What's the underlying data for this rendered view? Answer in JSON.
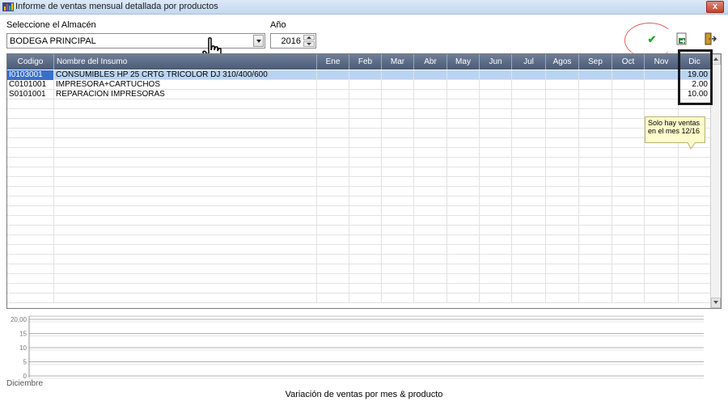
{
  "window": {
    "title": "Informe de ventas mensual detallada por productos",
    "close_label": "x"
  },
  "form": {
    "warehouse_label": "Seleccione el Almacén",
    "warehouse_value": "BODEGA PRINCIPAL",
    "year_label": "Año",
    "year_value": "2016"
  },
  "toolbar": {
    "ok_icon": "check-icon",
    "export_icon": "export-excel-icon",
    "exit_icon": "exit-door-icon"
  },
  "grid": {
    "columns": [
      "Codigo",
      "Nombre del Insumo",
      "Ene",
      "Feb",
      "Mar",
      "Abr",
      "May",
      "Jun",
      "Jul",
      "Agos",
      "Sep",
      "Oct",
      "Nov",
      "Dic"
    ],
    "rows": [
      {
        "code": "I0103001",
        "name": "CONSUMIBLES HP 25 CRTG TRICOLOR DJ 310/400/600",
        "dic": "19.00",
        "selected": true
      },
      {
        "code": "C0101001",
        "name": "IMPRESORA+CARTUCHOS",
        "dic": "2.00",
        "selected": false
      },
      {
        "code": "S0101001",
        "name": "REPARACIÓN IMPRESORAS",
        "dic": "10.00",
        "selected": false
      }
    ]
  },
  "note": "Solo hay ventas en el mes 12/16",
  "chart_data": {
    "type": "bar",
    "categories": [
      "Diciembre"
    ],
    "y_ticks": [
      "0",
      "5",
      "10",
      "15",
      "20,00"
    ],
    "ylim": [
      0,
      20
    ],
    "title": "Variación de ventas por mes & producto",
    "grid": true
  },
  "colors": {
    "header": "#5a6a85",
    "selected_row": "#b9d4f3",
    "note_bg": "#fdfbc9"
  }
}
